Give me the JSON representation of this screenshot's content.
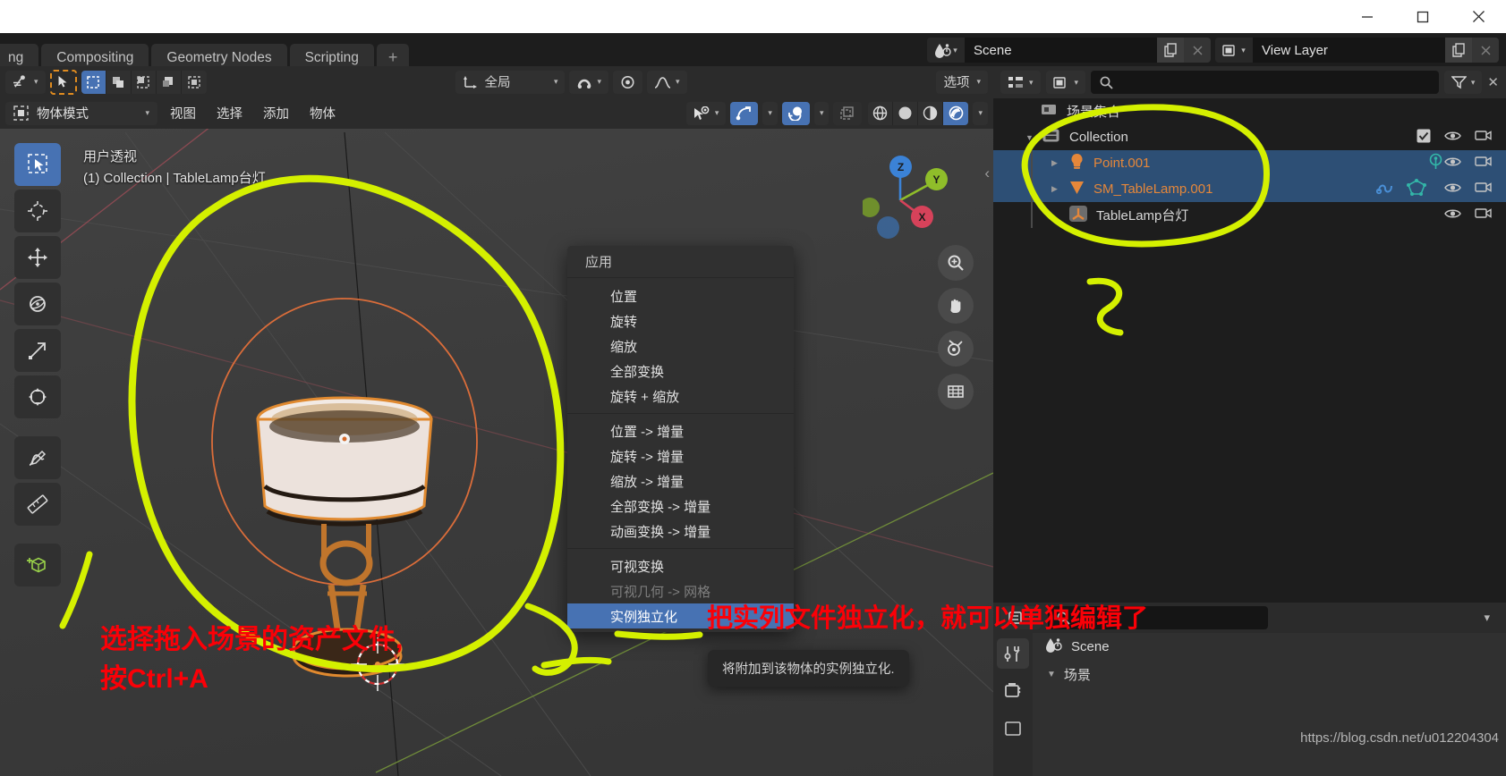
{
  "window": {
    "minimize": "—",
    "maximize": "☐",
    "close": "✕"
  },
  "topbar": {
    "tabs": [
      "ng",
      "Compositing",
      "Geometry Nodes",
      "Scripting"
    ],
    "add_tab": "+",
    "scene_label": "Scene",
    "view_layer_label": "View Layer",
    "new_scene_icon": "copy-icon",
    "remove_scene_icon": "x-icon",
    "scene_browse_icon": "scene-icon",
    "viewlayer_browse_icon": "viewlayer-icon",
    "new_viewlayer_icon": "copy-icon",
    "remove_viewlayer_icon": "x-icon"
  },
  "viewport": {
    "header_row1": {
      "editor_type_icon": "editor-type-icon",
      "cursor_tool_icon": "cursor-icon",
      "select_modes": [
        "select-box",
        "select-extend",
        "select-subtract",
        "select-difference",
        "select-intersect"
      ],
      "transform_orientation": "全局",
      "snap_icon": "snap-magnet-icon",
      "proportional_icon": "proportional-edit-icon",
      "proportional_falloff_icon": "falloff-smooth-icon",
      "options_label": "选项"
    },
    "header_row2": {
      "mode_label": "物体模式",
      "menus": [
        "视图",
        "选择",
        "添加",
        "物体"
      ],
      "visibility_icon": "eye-visibility-icon",
      "gizmo_icon": "gizmo-icon",
      "overlays_icon": "overlays-icon",
      "xray_icon": "xray-icon",
      "shading_modes": [
        "wireframe",
        "solid",
        "material-preview",
        "rendered"
      ],
      "shading_active": "rendered"
    },
    "overlay_line1": "用户透视",
    "overlay_line2": "(1) Collection | TableLamp台灯",
    "tools": [
      {
        "name": "tweak-tool",
        "active": true
      },
      {
        "name": "cursor-tool",
        "active": false
      },
      {
        "name": "move-tool",
        "active": false
      },
      {
        "name": "rotate-tool",
        "active": false
      },
      {
        "name": "scale-tool",
        "active": false
      },
      {
        "name": "transform-tool",
        "active": false
      },
      {
        "name": "annotate-tool",
        "active": false
      },
      {
        "name": "measure-tool",
        "active": false
      },
      {
        "name": "add-cube-tool",
        "active": false
      }
    ],
    "nav_axes": [
      {
        "label": "Z",
        "color": "#3b82d6"
      },
      {
        "label": "Y",
        "color": "#8fbd2a"
      },
      {
        "label": "X",
        "color": "#d6425a"
      }
    ],
    "nav_buttons": [
      "zoom-icon",
      "pan-hand-icon",
      "camera-icon",
      "grid-ortho-icon"
    ]
  },
  "apply_menu": {
    "title": "应用",
    "groups": [
      [
        "位置",
        "旋转",
        "缩放",
        "全部变换",
        "旋转 + 缩放"
      ],
      [
        "位置 -> 增量",
        "旋转 -> 增量",
        "缩放 -> 增量",
        "全部变换 -> 增量",
        "动画变换 -> 增量"
      ],
      [
        "可视变换",
        "可视几何 -> 网格",
        "实例独立化"
      ]
    ],
    "disabled_item": "可视几何 -> 网格",
    "highlighted_item": "实例独立化"
  },
  "tooltip": {
    "text": "将附加到该物体的实例独立化."
  },
  "outliner": {
    "display_mode_icon": "outliner-filter-icon",
    "view_layer_icon": "viewlayer-icon",
    "search_placeholder": "",
    "search_icon": "search-icon",
    "filter_icon": "filter-icon",
    "filter_caret_icon": "chevron-down-icon",
    "rows": [
      {
        "label": "场景集合",
        "indent": 0,
        "icon": "scene-collection-icon",
        "selected": false,
        "orange": false,
        "disclosure": "",
        "icons": []
      },
      {
        "label": "Collection",
        "indent": 1,
        "icon": "collection-icon",
        "selected": false,
        "orange": false,
        "disclosure": "▼",
        "icons": [
          "checkbox-checked",
          "eye-icon",
          "camera-icon"
        ]
      },
      {
        "label": "Point.001",
        "indent": 2,
        "icon": "light-bulb-icon",
        "selected": true,
        "orange": true,
        "disclosure": "▶",
        "icons": [
          "light-data-icon",
          "eye-icon",
          "camera-icon"
        ]
      },
      {
        "label": "SM_TableLamp.001",
        "indent": 2,
        "icon": "mesh-triangle-icon",
        "selected": true,
        "orange": true,
        "disclosure": "▶",
        "icons": [
          "modifier-icon",
          "mesh-data-icon",
          "eye-icon",
          "camera-icon"
        ]
      },
      {
        "label": "TableLamp台灯",
        "indent": 2,
        "icon": "empty-axes-icon",
        "selected": false,
        "orange": false,
        "disclosure": "",
        "icons": [
          "eye-icon",
          "camera-icon"
        ]
      }
    ]
  },
  "properties": {
    "editor_icon": "properties-editor-icon",
    "search_placeholder": "",
    "caret_icon": "chevron-down-icon",
    "breadcrumb_icon": "scene-icon",
    "breadcrumb_label": "Scene",
    "tabs": [
      "tool-icon",
      "render-icon",
      "output-icon"
    ],
    "active_tab": "tool-icon",
    "panel_label": "场景",
    "panel_disclosure": "▼"
  },
  "annotations": {
    "red_text_1_line1": "选择拖入场景的资产文件,",
    "red_text_1_line2": "按Ctrl+A",
    "red_text_2": "把实列文件独立化，就可以单独编辑了",
    "highlight_color": "#d4f000",
    "red_color": "#fb0007"
  },
  "watermark": {
    "url": "https://blog.csdn.net/u012204304"
  }
}
